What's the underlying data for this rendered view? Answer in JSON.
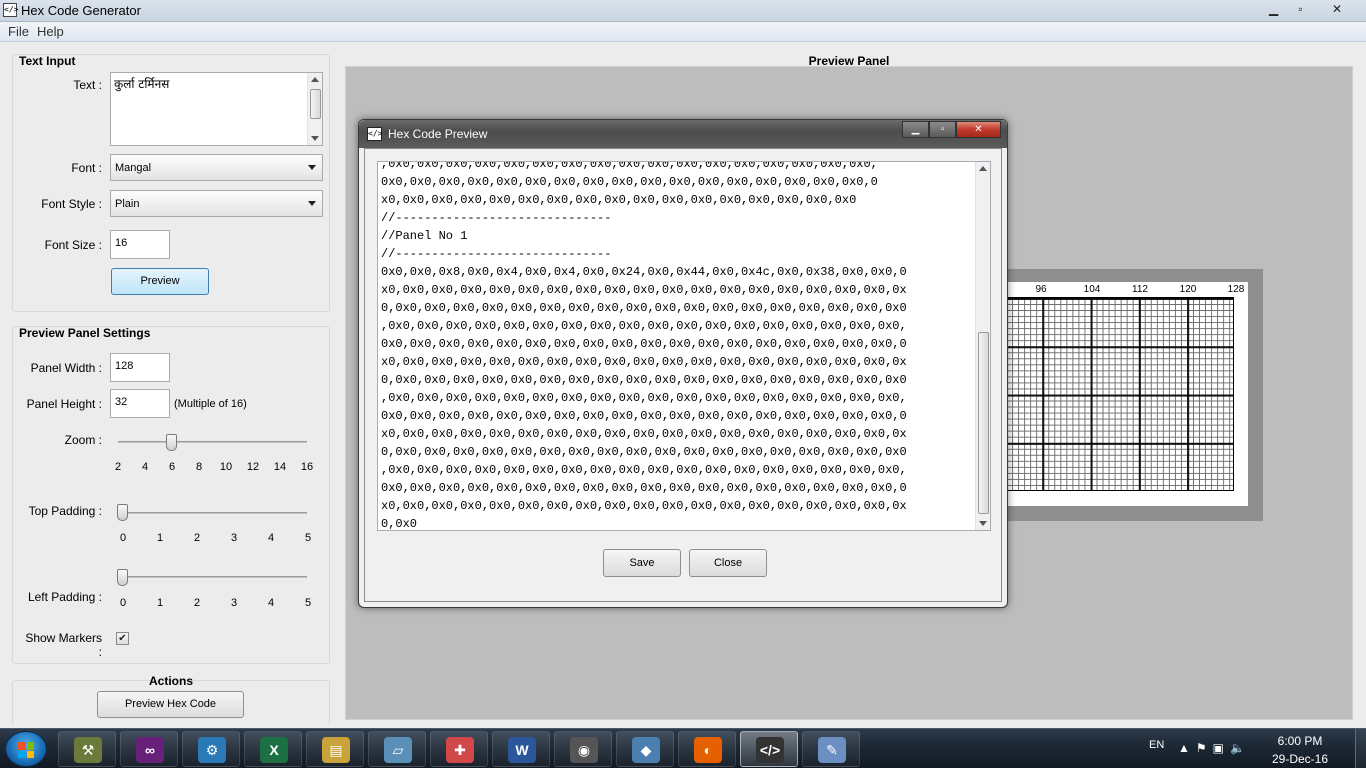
{
  "window": {
    "title": "Hex Code Generator",
    "minimize": "▁",
    "maximize": "▫",
    "close": "✕"
  },
  "menu": [
    "File",
    "Help"
  ],
  "text_input": {
    "title": "Text Input",
    "text_label": "Text :",
    "text_value": "कुर्ला टर्मिनस",
    "font_label": "Font :",
    "font_value": "Mangal",
    "font_style_label": "Font Style :",
    "font_style_value": "Plain",
    "font_size_label": "Font Size :",
    "font_size_value": "16",
    "preview_button": "Preview"
  },
  "panel_settings": {
    "title": "Preview Panel Settings",
    "width_label": "Panel Width :",
    "width_value": "128",
    "height_label": "Panel Height :",
    "height_value": "32",
    "height_hint": "(Multiple of 16)",
    "zoom_label": "Zoom :",
    "zoom_value": 6,
    "zoom_ticks": [
      "2",
      "4",
      "6",
      "8",
      "10",
      "12",
      "14",
      "16"
    ],
    "top_padding_label": "Top Padding :",
    "top_padding_value": 0,
    "left_padding_label": "Left Padding :",
    "left_padding_value": 0,
    "padding_ticks": [
      "0",
      "1",
      "2",
      "3",
      "4",
      "5"
    ],
    "show_markers_label": "Show Markers :",
    "show_markers_checked": true
  },
  "actions": {
    "title": "Actions",
    "preview_hex_button": "Preview Hex Code"
  },
  "preview_panel": {
    "title": "Preview Panel",
    "markers": [
      "96",
      "104",
      "112",
      "120",
      "128"
    ]
  },
  "dialog": {
    "title": "Hex Code Preview",
    "lines": [
      ",0x0,0x0,0x0,0x0,0x0,0x0,0x0,0x0,0x0,0x0,0x0,0x0,0x0,0x0,0x0,0x0,0x0,",
      "0x0,0x0,0x0,0x0,0x0,0x0,0x0,0x0,0x0,0x0,0x0,0x0,0x0,0x0,0x0,0x0,0x0,0",
      "x0,0x0,0x0,0x0,0x0,0x0,0x0,0x0,0x0,0x0,0x0,0x0,0x0,0x0,0x0,0x0,0x0",
      "//------------------------------",
      "//Panel No 1",
      "//------------------------------",
      "0x0,0x0,0x8,0x0,0x4,0x0,0x4,0x0,0x24,0x0,0x44,0x0,0x4c,0x0,0x38,0x0,0x0,0",
      "x0,0x0,0x0,0x0,0x0,0x0,0x0,0x0,0x0,0x0,0x0,0x0,0x0,0x0,0x0,0x0,0x0,0x0,0x",
      "0,0x0,0x0,0x0,0x0,0x0,0x0,0x0,0x0,0x0,0x0,0x0,0x0,0x0,0x0,0x0,0x0,0x0,0x0",
      ",0x0,0x0,0x0,0x0,0x0,0x0,0x0,0x0,0x0,0x0,0x0,0x0,0x0,0x0,0x0,0x0,0x0,0x0,",
      "0x0,0x0,0x0,0x0,0x0,0x0,0x0,0x0,0x0,0x0,0x0,0x0,0x0,0x0,0x0,0x0,0x0,0x0,0",
      "x0,0x0,0x0,0x0,0x0,0x0,0x0,0x0,0x0,0x0,0x0,0x0,0x0,0x0,0x0,0x0,0x0,0x0,0x",
      "0,0x0,0x0,0x0,0x0,0x0,0x0,0x0,0x0,0x0,0x0,0x0,0x0,0x0,0x0,0x0,0x0,0x0,0x0",
      ",0x0,0x0,0x0,0x0,0x0,0x0,0x0,0x0,0x0,0x0,0x0,0x0,0x0,0x0,0x0,0x0,0x0,0x0,",
      "0x0,0x0,0x0,0x0,0x0,0x0,0x0,0x0,0x0,0x0,0x0,0x0,0x0,0x0,0x0,0x0,0x0,0x0,0",
      "x0,0x0,0x0,0x0,0x0,0x0,0x0,0x0,0x0,0x0,0x0,0x0,0x0,0x0,0x0,0x0,0x0,0x0,0x",
      "0,0x0,0x0,0x0,0x0,0x0,0x0,0x0,0x0,0x0,0x0,0x0,0x0,0x0,0x0,0x0,0x0,0x0,0x0",
      ",0x0,0x0,0x0,0x0,0x0,0x0,0x0,0x0,0x0,0x0,0x0,0x0,0x0,0x0,0x0,0x0,0x0,0x0,",
      "0x0,0x0,0x0,0x0,0x0,0x0,0x0,0x0,0x0,0x0,0x0,0x0,0x0,0x0,0x0,0x0,0x0,0x0,0",
      "x0,0x0,0x0,0x0,0x0,0x0,0x0,0x0,0x0,0x0,0x0,0x0,0x0,0x0,0x0,0x0,0x0,0x0,0x",
      "0,0x0"
    ],
    "save_button": "Save",
    "close_button": "Close"
  },
  "taskbar": {
    "apps": [
      "tools-icon",
      "visual-studio-icon",
      "cloud-gears-icon",
      "excel-icon",
      "file-explorer-icon",
      "notes-icon",
      "calendar-add-icon",
      "word-icon",
      "media-icon",
      "box-icon",
      "firefox-icon",
      "hex-code-generator-icon",
      "paint-icon"
    ],
    "language": "EN",
    "time": "6:00 PM",
    "date": "29-Dec-16"
  }
}
